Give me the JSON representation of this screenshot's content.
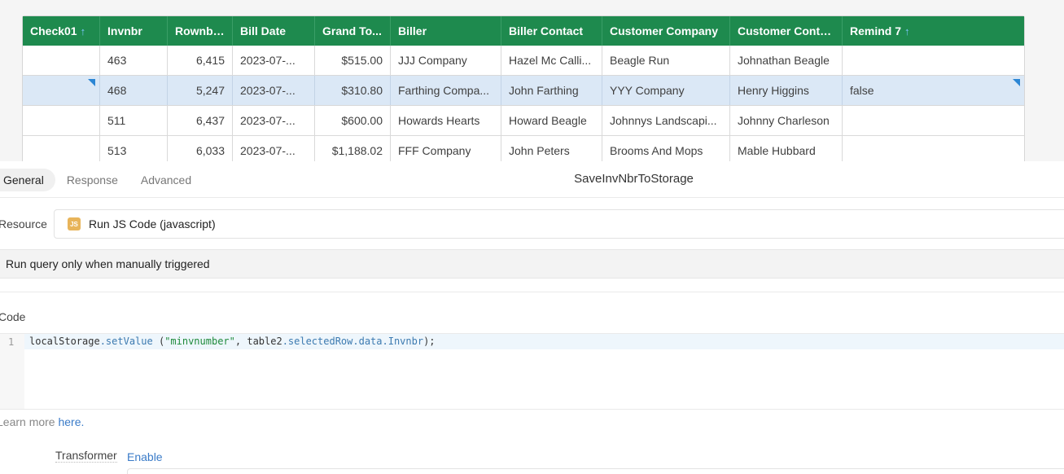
{
  "table": {
    "columns": [
      "Check01",
      "Invnbr",
      "Rownbr...",
      "Bill Date",
      "Grand To...",
      "Biller",
      "Biller Contact",
      "Customer Company",
      "Customer Conta...",
      "Remind 7"
    ],
    "sort_indicator": "↑",
    "rows": [
      [
        "",
        "463",
        "6,415",
        "2023-07-...",
        "$515.00",
        "JJJ Company",
        "Hazel Mc Calli...",
        "Beagle Run",
        "Johnathan Beagle",
        ""
      ],
      [
        "",
        "468",
        "5,247",
        "2023-07-...",
        "$310.80",
        "Farthing Compa...",
        "John Farthing",
        "YYY Company",
        "Henry Higgins",
        "false"
      ],
      [
        "",
        "511",
        "6,437",
        "2023-07-...",
        "$600.00",
        "Howards Hearts",
        "Howard Beagle",
        "Johnnys Landscapi...",
        "Johnny Charleson",
        ""
      ],
      [
        "",
        "513",
        "6,033",
        "2023-07-...",
        "$1,188.02",
        "FFF Company",
        "John Peters",
        "Brooms And Mops",
        "Mable Hubbard",
        ""
      ]
    ]
  },
  "panel": {
    "tabs": [
      {
        "label": "General",
        "active": true
      },
      {
        "label": "Response",
        "active": false
      },
      {
        "label": "Advanced",
        "active": false
      }
    ],
    "query_name": "SaveInvNbrToStorage",
    "resource_label": "Resource",
    "resource_badge": "JS",
    "resource_value": "Run JS Code (javascript)",
    "trigger_text": "Run query only when manually triggered",
    "code_label": "Code",
    "code_line_number": "1",
    "code": {
      "t1": "localStorage",
      "t2": ".setValue",
      "t3": " (",
      "t4": "\"minvnumber\"",
      "t5": ", table2",
      "t6": ".selectedRow.data.Invnbr",
      "t7": ");"
    },
    "learn_prefix": "Learn more ",
    "learn_link": "here.",
    "transformer_label": "Transformer",
    "transformer_action": "Enable"
  },
  "colors": {
    "header_green": "#1e8a4e",
    "selected_row": "#dbe8f6",
    "link_blue": "#3a7bc8",
    "js_badge": "#e8b45a"
  }
}
